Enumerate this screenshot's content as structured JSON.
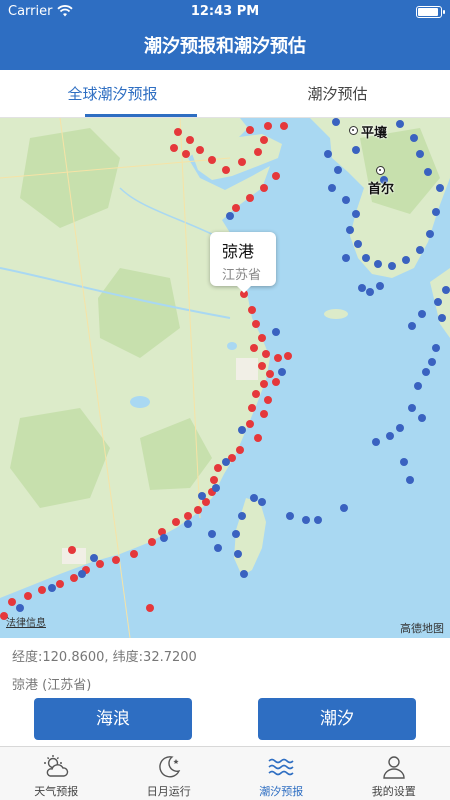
{
  "status": {
    "carrier": "Carrier",
    "time": "12:43 PM"
  },
  "nav": {
    "title": "潮汐预报和潮汐预估"
  },
  "tabs": [
    {
      "label": "全球潮汐预报",
      "active": true
    },
    {
      "label": "潮汐预估",
      "active": false
    }
  ],
  "map": {
    "popup": {
      "name": "弶港",
      "province": "江苏省"
    },
    "cities": [
      {
        "name": "平壤"
      },
      {
        "name": "首尔"
      }
    ],
    "legal": "法律信息",
    "logo": "高德地图"
  },
  "info": {
    "coords": "经度:120.8600, 纬度:32.7200",
    "location": "弶港 (江苏省)"
  },
  "buttons": {
    "wave": "海浪",
    "tide": "潮汐"
  },
  "tabbar": [
    {
      "label": "天气预报",
      "icon": "weather-icon",
      "active": false
    },
    {
      "label": "日月运行",
      "icon": "moon-icon",
      "active": false
    },
    {
      "label": "潮汐预报",
      "icon": "waves-icon",
      "active": true
    },
    {
      "label": "我的设置",
      "icon": "user-icon",
      "active": false
    }
  ],
  "colors": {
    "primary": "#2e6ec2",
    "sea": "#a9d8f2",
    "land": "#dcebc9",
    "marker_red": "#e5383b",
    "marker_blue": "#3a62c0"
  }
}
